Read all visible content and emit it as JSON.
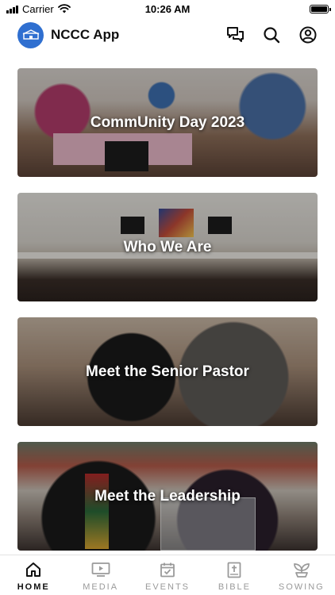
{
  "status_bar": {
    "carrier": "Carrier",
    "time": "10:26 AM",
    "battery_level": 1.0
  },
  "header": {
    "title": "NCCC App",
    "logo_color": "#2f6fd0",
    "icons": [
      "chat-bubbles-icon",
      "search-icon",
      "profile-icon"
    ]
  },
  "cards": [
    {
      "title": "CommUnity Day 2023"
    },
    {
      "title": "Who We Are"
    },
    {
      "title": "Meet the Senior Pastor"
    },
    {
      "title": "Meet the Leadership"
    }
  ],
  "tabs": [
    {
      "label": "HOME",
      "icon": "home-icon",
      "active": true
    },
    {
      "label": "MEDIA",
      "icon": "media-icon",
      "active": false
    },
    {
      "label": "EVENTS",
      "icon": "events-icon",
      "active": false
    },
    {
      "label": "BIBLE",
      "icon": "bible-icon",
      "active": false
    },
    {
      "label": "SOWING",
      "icon": "sowing-icon",
      "active": false
    }
  ],
  "colors": {
    "active_tab": "#111111",
    "inactive_tab": "#9a9a9a"
  }
}
